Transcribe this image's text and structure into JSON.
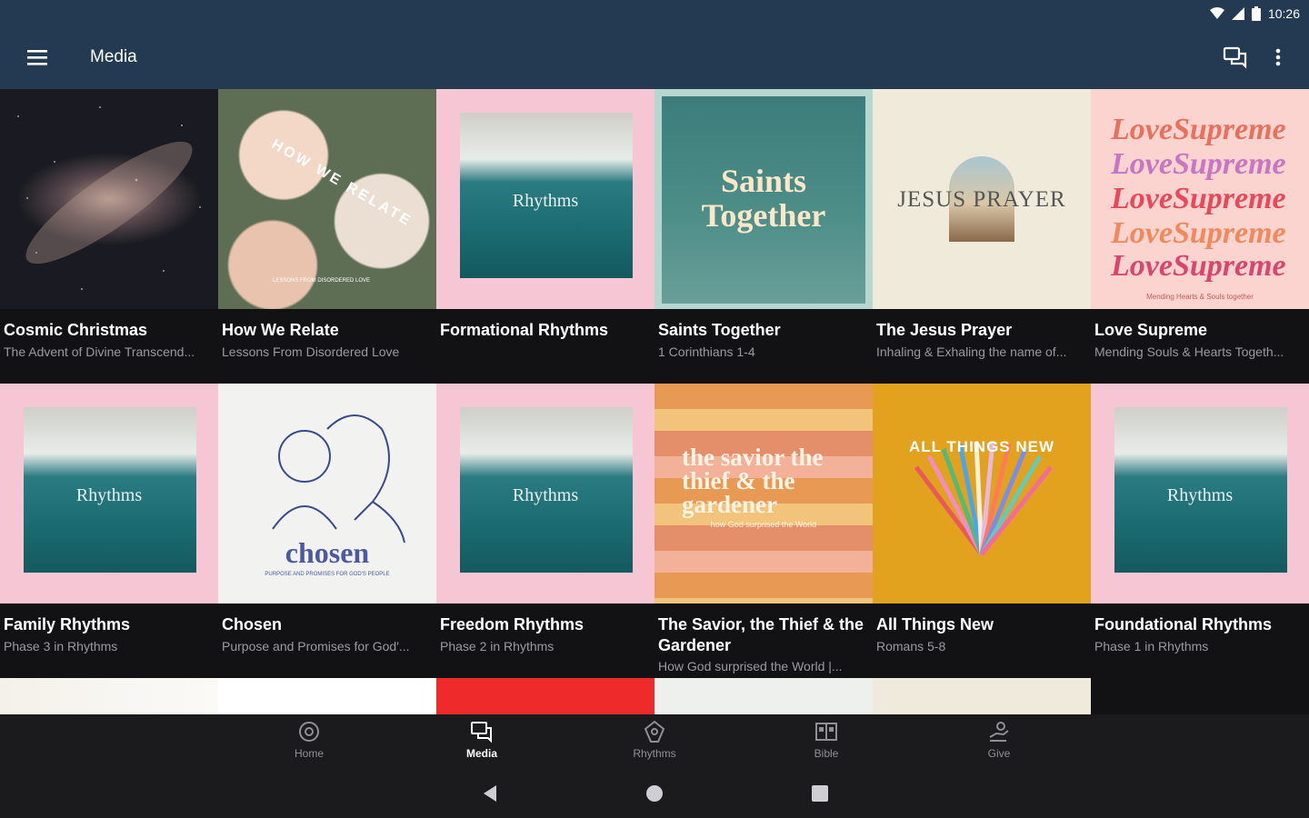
{
  "status": {
    "time": "10:26"
  },
  "appbar": {
    "title": "Media"
  },
  "cards": [
    {
      "title": "Cosmic Christmas",
      "subtitle": "The Advent of Divine Transcend...",
      "art_text": ""
    },
    {
      "title": "How We Relate",
      "subtitle": "Lessons From Disordered Love",
      "art_text": "HOW WE RELATE",
      "art_small": "LESSONS FROM DISORDERED LOVE"
    },
    {
      "title": "Formational Rhythms",
      "subtitle": "",
      "art_text": "Rhythms"
    },
    {
      "title": "Saints Together",
      "subtitle": "1 Corinthians 1-4",
      "art_text": "Saints Together"
    },
    {
      "title": "The Jesus Prayer",
      "subtitle": "Inhaling & Exhaling the name of...",
      "art_text": "JESUS PRAYER"
    },
    {
      "title": "Love Supreme",
      "subtitle": "Mending Souls & Hearts Togeth...",
      "art_text": "LoveSupreme",
      "art_small": "Mending Hearts & Souls together"
    },
    {
      "title": "Family Rhythms",
      "subtitle": "Phase 3 in Rhythms",
      "art_text": "Rhythms"
    },
    {
      "title": "Chosen",
      "subtitle": "Purpose and Promises for God'...",
      "art_text": "chosen",
      "art_small": "PURPOSE AND PROMISES FOR GOD'S PEOPLE"
    },
    {
      "title": "Freedom Rhythms",
      "subtitle": "Phase 2 in Rhythms",
      "art_text": "Rhythms"
    },
    {
      "title": "The Savior, the Thief & the Gardener",
      "subtitle": "How God surprised the World |...",
      "art_text": "the savior the thief & the gardener",
      "art_small": "how God surprised the World"
    },
    {
      "title": "All Things New",
      "subtitle": "Romans 5-8",
      "art_text": "ALL THINGS NEW"
    },
    {
      "title": "Foundational Rhythms",
      "subtitle": "Phase 1 in Rhythms",
      "art_text": "Rhythms"
    }
  ],
  "nav": [
    {
      "label": "Home",
      "icon": "home-icon",
      "active": false
    },
    {
      "label": "Media",
      "icon": "media-icon",
      "active": true
    },
    {
      "label": "Rhythms",
      "icon": "rhythms-icon",
      "active": false
    },
    {
      "label": "Bible",
      "icon": "bible-icon",
      "active": false
    },
    {
      "label": "Give",
      "icon": "give-icon",
      "active": false
    }
  ],
  "colors": {
    "appbar": "#243a52",
    "background": "#121214",
    "pink": "#f7c6d4",
    "teal": "#1a6d72"
  }
}
